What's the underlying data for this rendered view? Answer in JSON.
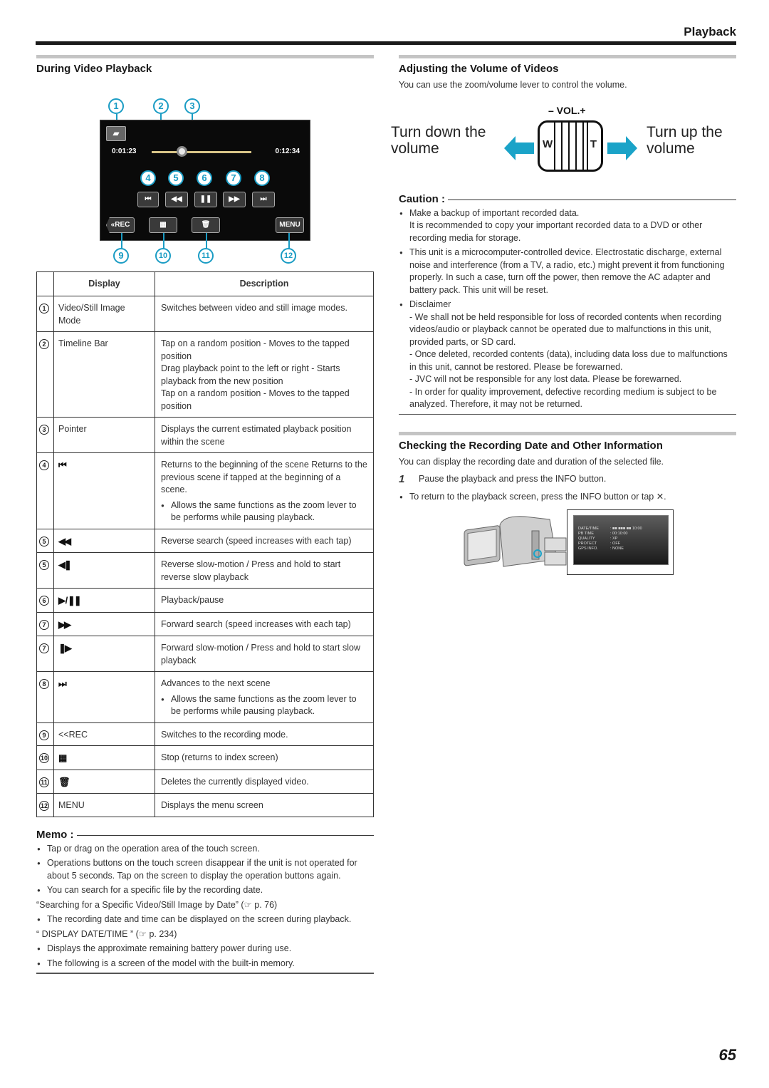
{
  "header": {
    "title": "Playback"
  },
  "page_number": "65",
  "left": {
    "section_title": "During Video Playback",
    "screen": {
      "callouts": [
        "1",
        "2",
        "3",
        "4",
        "5",
        "6",
        "7",
        "8",
        "9",
        "10",
        "11",
        "12"
      ],
      "time_elapsed": "0:01:23",
      "time_total": "0:12:34",
      "progress_fraction": 0.3,
      "mode_icon": "video-camera-icon",
      "buttons": {
        "skip_back": "⏮",
        "rewind": "◀◀",
        "pause": "❚❚",
        "fast_forward": "▶▶",
        "skip_forward": "⏭",
        "rec": "«REC",
        "index": "▦",
        "delete": "🗑",
        "menu": "MENU"
      }
    },
    "table": {
      "headers": [
        "Display",
        "Description"
      ],
      "rows": [
        {
          "num": "1",
          "display": "Video/Still Image Mode",
          "description": "Switches between video and still image modes.",
          "note": ""
        },
        {
          "num": "2",
          "display": "Timeline Bar",
          "description": "Tap on a random position - Moves to the tapped position\nDrag playback point to the left or right - Starts playback from the new position\nTap on a random position - Moves to the tapped position",
          "note": ""
        },
        {
          "num": "3",
          "display": "Pointer",
          "description": "Displays the current estimated playback position within the scene",
          "note": ""
        },
        {
          "num": "4",
          "display": "⏮",
          "icon": "skip-back-icon",
          "description": "Returns to the beginning of the scene Returns to the previous scene if tapped at the beginning of a scene.",
          "note": "Allows the same functions as the zoom lever to be performs while pausing playback."
        },
        {
          "num": "5",
          "display": "◀◀",
          "icon": "rewind-icon",
          "description": "Reverse search (speed increases with each tap)",
          "note": ""
        },
        {
          "num": "5",
          "display": "◀❚",
          "icon": "reverse-slow-icon",
          "description": "Reverse slow-motion / Press and hold to start reverse slow playback",
          "note": ""
        },
        {
          "num": "6",
          "display": "▶ / ❚❚",
          "icon": "play-pause-icon",
          "description": "Playback/pause",
          "note": ""
        },
        {
          "num": "7",
          "display": "▶▶",
          "icon": "fast-forward-icon",
          "description": "Forward search (speed increases with each tap)",
          "note": ""
        },
        {
          "num": "7",
          "display": "❚▶",
          "icon": "forward-slow-icon",
          "description": "Forward slow-motion / Press and hold to start slow playback",
          "note": ""
        },
        {
          "num": "8",
          "display": "⏭",
          "icon": "skip-forward-icon",
          "description": "Advances to the next scene",
          "note": "Allows the same functions as the zoom lever to be performs while pausing playback."
        },
        {
          "num": "9",
          "display": "<<REC",
          "description": "Switches to the recording mode.",
          "note": ""
        },
        {
          "num": "10",
          "display": "▦",
          "icon": "index-icon",
          "description": "Stop (returns to index screen)",
          "note": ""
        },
        {
          "num": "11",
          "display": "🗑",
          "icon": "trash-icon",
          "description": "Deletes the currently displayed video.",
          "note": ""
        },
        {
          "num": "12",
          "display": "MENU",
          "description": "Displays the menu screen",
          "note": ""
        }
      ]
    },
    "memo": {
      "title": "Memo :",
      "items": [
        {
          "type": "bullet",
          "text": "Tap or drag on the operation area of the touch screen."
        },
        {
          "type": "bullet",
          "text": "Operations buttons on the touch screen disappear if the unit is not operated for about 5 seconds. Tap on the screen to display the operation buttons again."
        },
        {
          "type": "bullet",
          "text": "You can search for a specific file by the recording date."
        },
        {
          "type": "ref",
          "text": "“Searching for a Specific Video/Still Image by Date” (☞ p. 76)"
        },
        {
          "type": "bullet",
          "text": "The recording date and time can be displayed on the screen during playback."
        },
        {
          "type": "ref",
          "text": "“ DISPLAY DATE/TIME ” (☞ p. 234)"
        },
        {
          "type": "bullet",
          "text": "Displays the approximate remaining battery power during use."
        },
        {
          "type": "bullet",
          "text": "The following is a screen of the model with the built-in memory."
        }
      ]
    }
  },
  "right": {
    "volume": {
      "section_title": "Adjusting the Volume of Videos",
      "intro": "You can use the zoom/volume lever to control the volume.",
      "lever_label": "– VOL.+",
      "w_label": "W",
      "t_label": "T",
      "down_text": "Turn down the volume",
      "up_text": "Turn up the volume",
      "arrow_color": "#1aa3c8"
    },
    "caution": {
      "title": "Caution :",
      "items": [
        {
          "text": "Make a backup of important recorded data.",
          "sub": [
            "It is recommended to copy your important recorded data to a DVD or other recording media for storage."
          ]
        },
        {
          "text": "This unit is a microcomputer-controlled device. Electrostatic discharge, external noise and interference (from a TV, a radio, etc.) might prevent it from functioning properly. In such a case, turn off the power, then remove the AC adapter and battery pack. This unit will be reset.",
          "sub": []
        },
        {
          "text": "Disclaimer",
          "sub": [
            "- We shall not be held responsible for loss of recorded contents when recording videos/audio or playback cannot be operated due to malfunctions in this unit, provided parts, or SD card.",
            "- Once deleted, recorded contents (data), including data loss due to malfunctions in this unit, cannot be restored. Please be forewarned.",
            "- JVC will not be responsible for any lost data. Please be forewarned.",
            "- In order for quality improvement, defective recording medium is subject to be analyzed. Therefore, it may not be returned."
          ]
        }
      ]
    },
    "info": {
      "section_title": "Checking the Recording Date and Other Information",
      "intro": "You can display the recording date and duration of the selected file.",
      "step_num": "1",
      "step_text": "Pause the playback and press the INFO button.",
      "bullet": "To return to the playback screen, press the INFO button or tap ✕.",
      "screen_rows": [
        {
          "k": "DATE/TIME",
          "v": ": ■■ ■■■ ■■ 10:00"
        },
        {
          "k": "PB TIME",
          "v": ": 00:10:00"
        },
        {
          "k": "QUALITY",
          "v": ": XP"
        },
        {
          "k": "PROTECT",
          "v": ": OFF"
        },
        {
          "k": "GPS INFO.",
          "v": ": NONE"
        }
      ]
    }
  }
}
